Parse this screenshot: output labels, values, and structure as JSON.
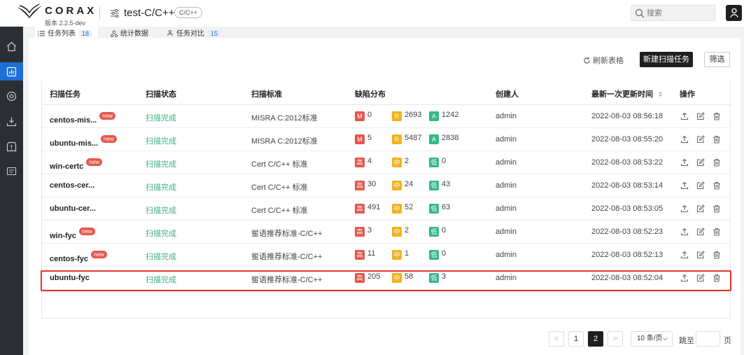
{
  "header": {
    "brand": "CORAX",
    "version": "版本 2.2.5-dev",
    "project_name": "test-C/C++",
    "language_badge": "C/C++",
    "search_placeholder": "搜索"
  },
  "tabs": [
    {
      "label": "任务列表",
      "count": "18",
      "icon": "list-icon"
    },
    {
      "label": "统计数据",
      "icon": "stats-icon"
    },
    {
      "label": "任务对比",
      "count": "15",
      "icon": "compare-icon"
    }
  ],
  "toolbar": {
    "refresh_label": "刷新表格",
    "new_scan_label": "新建扫描任务",
    "filter_label": "筛选"
  },
  "table": {
    "columns": [
      "扫描任务",
      "扫描状态",
      "扫描标准",
      "缺陷分布",
      "创建人",
      "最新一次更新时间",
      "操作"
    ],
    "new_tag": "new",
    "rows": [
      {
        "name": "centos-mis...",
        "is_new": true,
        "status": "扫描完成",
        "standard": "MISRA C:2012标准",
        "d1_label": "M",
        "d1": "0",
        "d2_label": "R",
        "d2": "2693",
        "d3_label": "A",
        "d3": "1242",
        "creator": "admin",
        "updated": "2022-08-03 08:56:18"
      },
      {
        "name": "ubuntu-mis...",
        "is_new": true,
        "status": "扫描完成",
        "standard": "MISRA C:2012标准",
        "d1_label": "M",
        "d1": "5",
        "d2_label": "R",
        "d2": "5487",
        "d3_label": "A",
        "d3": "2838",
        "creator": "admin",
        "updated": "2022-08-03 08:55:20"
      },
      {
        "name": "win-certc",
        "is_new": true,
        "status": "扫描完成",
        "standard": "Cert C/C++ 标准",
        "d1_label": "高",
        "d1": "4",
        "d2_label": "中",
        "d2": "2",
        "d3_label": "低",
        "d3": "0",
        "creator": "admin",
        "updated": "2022-08-03 08:53:22"
      },
      {
        "name": "centos-cer...",
        "is_new": false,
        "status": "扫描完成",
        "standard": "Cert C/C++ 标准",
        "d1_label": "高",
        "d1": "30",
        "d2_label": "中",
        "d2": "24",
        "d3_label": "低",
        "d3": "43",
        "creator": "admin",
        "updated": "2022-08-03 08:53:14"
      },
      {
        "name": "ubuntu-cer...",
        "is_new": false,
        "status": "扫描完成",
        "standard": "Cert C/C++ 标准",
        "d1_label": "高",
        "d1": "491",
        "d2_label": "中",
        "d2": "52",
        "d3_label": "低",
        "d3": "63",
        "creator": "admin",
        "updated": "2022-08-03 08:53:05"
      },
      {
        "name": "win-fyc",
        "is_new": true,
        "status": "扫描完成",
        "standard": "鲎语推荐标准-C/C++",
        "d1_label": "高",
        "d1": "3",
        "d2_label": "中",
        "d2": "2",
        "d3_label": "低",
        "d3": "0",
        "creator": "admin",
        "updated": "2022-08-03 08:52:23"
      },
      {
        "name": "centos-fyc",
        "is_new": true,
        "status": "扫描完成",
        "standard": "鲎语推荐标准-C/C++",
        "d1_label": "高",
        "d1": "11",
        "d2_label": "中",
        "d2": "1",
        "d3_label": "低",
        "d3": "0",
        "creator": "admin",
        "updated": "2022-08-03 08:52:13"
      },
      {
        "name": "ubuntu-fyc",
        "is_new": false,
        "status": "扫描完成",
        "standard": "鲎语推荐标准-C/C++",
        "d1_label": "高",
        "d1": "205",
        "d2_label": "中",
        "d2": "58",
        "d3_label": "低",
        "d3": "3",
        "creator": "admin",
        "updated": "2022-08-03 08:52:04"
      }
    ]
  },
  "pagination": {
    "prev": "<",
    "pages": [
      "1",
      "2"
    ],
    "current": "2",
    "next": ">",
    "page_size": "10 条/页",
    "jump_label": "跳至",
    "page_label": "页"
  },
  "colors": {
    "accent": "#1d6fd6",
    "status_done": "#3bb27c",
    "high": "#e4574a",
    "medium": "#f2b11e",
    "low": "#35b886",
    "highlight_border": "#e2322b"
  }
}
